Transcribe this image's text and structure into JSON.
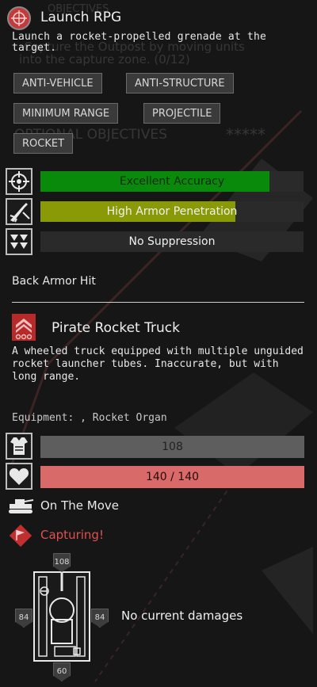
{
  "weapon": {
    "title": "Launch RPG",
    "description": "Launch a rocket-propelled grenade at the target.",
    "tags": [
      "ANTI-VEHICLE",
      "ANTI-STRUCTURE",
      "MINIMUM RANGE",
      "PROJECTILE",
      "ROCKET"
    ]
  },
  "stats": [
    {
      "label": "Excellent Accuracy",
      "fill": 0.87,
      "color": "#0a8a0a",
      "icon": "crosshair-icon"
    },
    {
      "label": "High Armor Penetration",
      "fill": 0.74,
      "color": "#8a9a06",
      "icon": "rocket-penetration-icon"
    },
    {
      "label": "No Suppression",
      "fill": 0,
      "color": "#2a2a2a",
      "icon": "suppression-arrows-icon"
    }
  ],
  "hit_result": "Back Armor Hit",
  "unit": {
    "name": "Pirate Rocket Truck",
    "icon": "rank-chevrons-icon",
    "description": "A wheeled truck equipped with multiple unguided rocket launcher tubes. Inaccurate, but with long range.",
    "equipment": "Equipment: , Rocket Organ",
    "armor_value": "108",
    "armor_fill": 1.0,
    "health_value": "140 / 140",
    "health_fill": 1.0,
    "status_moving": "On The Move",
    "status_capturing": "Capturing!",
    "damage_text": "No current damages",
    "armor_diagram": {
      "front": "108",
      "left": "84",
      "right": "84",
      "rear": "60"
    }
  },
  "background_text": {
    "line1": "Capture the Outpost by moving units",
    "line2": "into the capture zone. (0/12)",
    "line3": "OBJECTIVES",
    "line4": "OPTIONAL OBJECTIVES",
    "stars": "*****"
  },
  "colors": {
    "accuracy": "#0a8a0a",
    "penetration": "#8a9a06",
    "armor_bar": "#5e5e5e",
    "health_bar": "#d96a6a",
    "capturing": "#e05050"
  }
}
